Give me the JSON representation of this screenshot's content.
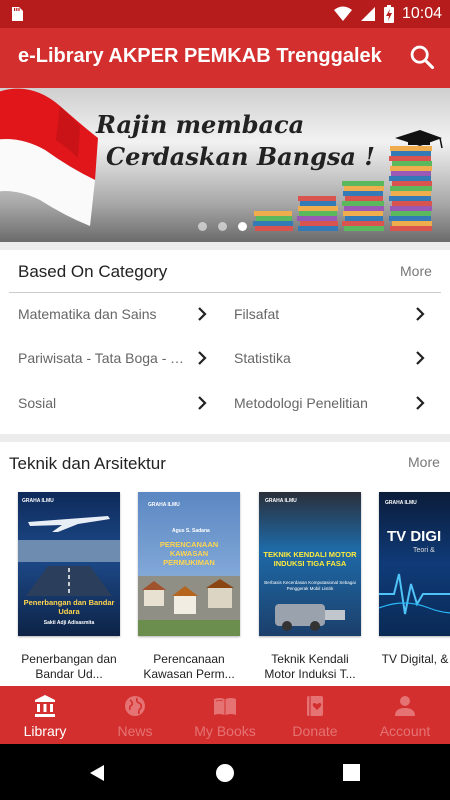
{
  "status_bar": {
    "time": "10:04"
  },
  "app_bar": {
    "title": "e-Library AKPER PEMKAB Trenggalek",
    "search_icon": "search-icon"
  },
  "banner": {
    "line1": "Rajin membaca",
    "line2": "Cerdaskan Bangsa !",
    "slide_count": 3,
    "active_slide": 3
  },
  "category_section": {
    "title": "Based On Category",
    "more_label": "More",
    "items": [
      {
        "label": "Matematika dan Sains"
      },
      {
        "label": "Filsafat"
      },
      {
        "label": "Pariwisata - Tata Boga - T..."
      },
      {
        "label": "Statistika"
      },
      {
        "label": "Sosial"
      },
      {
        "label": "Metodologi Penelitian"
      }
    ]
  },
  "books_section": {
    "title": "Teknik dan Arsitektur",
    "more_label": "More",
    "books": [
      {
        "title": "Penerbangan dan Bandar Ud...",
        "cover_title": "Penerbangan dan Bandar Udara",
        "cover_author": "Sakti Adji Adisasmita",
        "publisher": "GRAHA ILMU"
      },
      {
        "title": "Perencanaan Kawasan Perm...",
        "cover_title": "PERENCANAAN KAWASAN PERMUKIMAN",
        "cover_author": "Agus S. Sadana",
        "publisher": "GRAHA ILMU"
      },
      {
        "title": "Teknik Kendali Motor Induksi T...",
        "cover_title": "TEKNIK KENDALI MOTOR INDUKSI TIGA FASA",
        "cover_subtitle": "Berbasis Kecerdasan Komputasional Sebagai Penggerak Mobil Listrik",
        "publisher": "GRAHA ILMU"
      },
      {
        "title": "TV Digital, & Siste",
        "cover_title": "TV DIGI",
        "cover_subtitle": "Teori &",
        "publisher": "GRAHA ILMU"
      }
    ]
  },
  "bottom_nav": {
    "items": [
      {
        "label": "Library",
        "icon": "library-icon",
        "active": true
      },
      {
        "label": "News",
        "icon": "globe-icon",
        "active": false
      },
      {
        "label": "My Books",
        "icon": "book-open-icon",
        "active": false
      },
      {
        "label": "Donate",
        "icon": "heart-book-icon",
        "active": false
      },
      {
        "label": "Account",
        "icon": "person-icon",
        "active": false
      }
    ]
  },
  "colors": {
    "primary": "#d32f2f",
    "primary_dark": "#b71c1c",
    "nav_inactive": "#e57373"
  }
}
